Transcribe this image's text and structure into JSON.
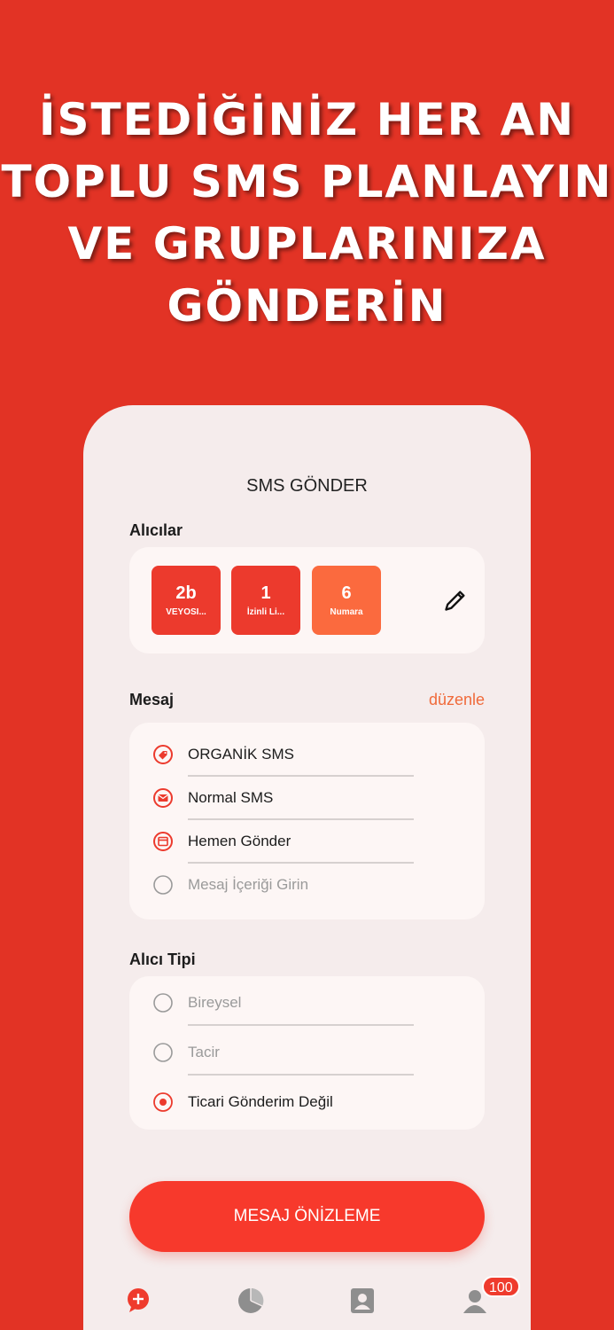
{
  "headline": {
    "lines": [
      "İSTEDİĞİNİZ HER AN",
      "TOPLU SMS PLANLAYIN",
      "VE GRUPLARINIZA",
      "GÖNDERİN"
    ]
  },
  "screen": {
    "title": "SMS GÖNDER",
    "recipients": {
      "label": "Alıcılar",
      "chips": [
        {
          "value": "2b",
          "label": "VEYOSI..."
        },
        {
          "value": "1",
          "label": "İzinli Li..."
        },
        {
          "value": "6",
          "label": "Numara"
        }
      ]
    },
    "message": {
      "label": "Mesaj",
      "edit_label": "düzenle",
      "rows": [
        {
          "text": "ORGANİK SMS",
          "icon": "tag-icon"
        },
        {
          "text": "Normal SMS",
          "icon": "envelope-icon"
        },
        {
          "text": "Hemen Gönder",
          "icon": "calendar-icon"
        },
        {
          "text": "Mesaj İçeriği Girin",
          "icon": "empty-radio-icon"
        }
      ]
    },
    "recipient_type": {
      "label": "Alıcı Tipi",
      "options": [
        {
          "text": "Bireysel",
          "selected": false
        },
        {
          "text": "Tacir",
          "selected": false
        },
        {
          "text": "Ticari Gönderim Değil",
          "selected": true
        }
      ]
    },
    "cta_label": "MESAJ ÖNİZLEME",
    "tabbar": {
      "tabs": [
        "new-message-tab",
        "reports-tab",
        "contacts-tab",
        "profile-tab"
      ],
      "badge": "100"
    }
  },
  "colors": {
    "background": "#e23325",
    "accent": "#ec3a2d",
    "accent_orange": "#fb6a3e",
    "link": "#f06a3a"
  }
}
